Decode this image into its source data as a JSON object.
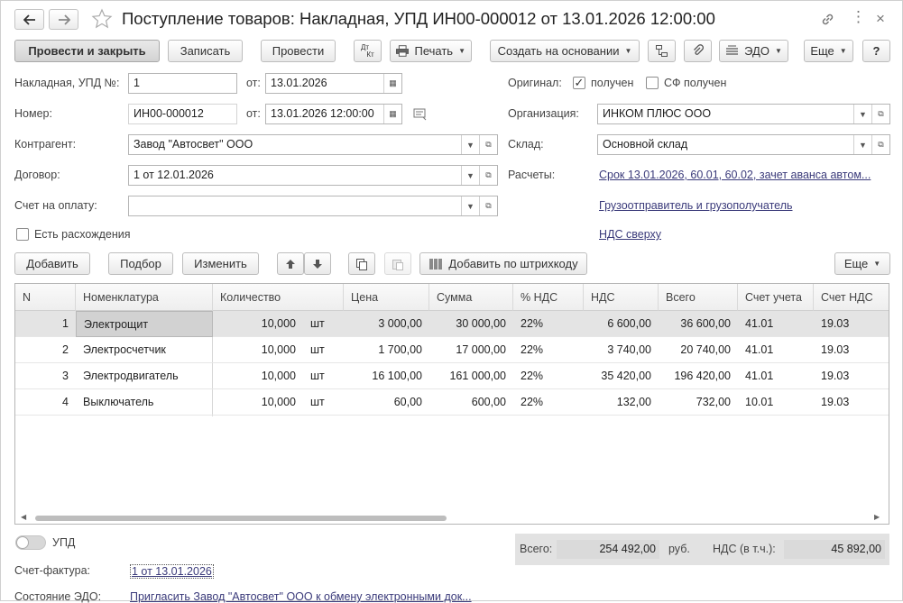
{
  "window": {
    "title": "Поступление товаров: Накладная, УПД ИН00-000012 от 13.01.2026 12:00:00",
    "back_icon": "arrow-left-icon",
    "forward_icon": "arrow-right-icon",
    "favorite_icon": "star-icon",
    "link_icon": "link-icon",
    "more_icon": "dots-icon",
    "close_icon": "close-icon"
  },
  "toolbar": {
    "post_close": "Провести и закрыть",
    "save": "Записать",
    "post": "Провести",
    "dtkt_top": "Дт",
    "dtkt_bottom": "Кт",
    "print": "Печать",
    "create_based": "Создать на основании",
    "edo": "ЭДО",
    "more": "Еще",
    "help": "?"
  },
  "form": {
    "invoice_label": "Накладная, УПД №:",
    "invoice_value": "1",
    "from_label": "от:",
    "invoice_date": "13.01.2026",
    "number_label": "Номер:",
    "number_value": "ИН00-000012",
    "number_date": "13.01.2026 12:00:00",
    "contractor_label": "Контрагент:",
    "contractor_value": "Завод \"Автосвет\" ООО",
    "contract_label": "Договор:",
    "contract_value": "1 от 12.01.2026",
    "payment_label": "Счет на оплату:",
    "payment_value": "",
    "discrepancy_label": "Есть расхождения",
    "original_label": "Оригинал:",
    "received_label": "получен",
    "sf_received_label": "СФ получен",
    "org_label": "Организация:",
    "org_value": "ИНКОМ ПЛЮС ООО",
    "warehouse_label": "Склад:",
    "warehouse_value": "Основной склад",
    "settlements_label": "Расчеты:",
    "settlements_link": "Срок 13.01.2026, 60.01, 60.02, зачет аванса автом...",
    "shipper_link": "Грузоотправитель и грузополучатель",
    "vat_link": "НДС сверху"
  },
  "table_toolbar": {
    "add": "Добавить",
    "pick": "Подбор",
    "edit": "Изменить",
    "barcode": "Добавить по штрихкоду",
    "more": "Еще"
  },
  "table": {
    "headers": [
      "N",
      "Номенклатура",
      "Количество",
      "Цена",
      "Сумма",
      "% НДС",
      "НДС",
      "Всего",
      "Счет учета",
      "Счет НДС"
    ],
    "rows": [
      {
        "n": "1",
        "name": "Электрощит",
        "qty": "10,000",
        "unit": "шт",
        "price": "3 000,00",
        "sum": "30 000,00",
        "vat_rate": "22%",
        "vat": "6 600,00",
        "total": "36 600,00",
        "account": "41.01",
        "vat_account": "19.03"
      },
      {
        "n": "2",
        "name": "Электросчетчик",
        "qty": "10,000",
        "unit": "шт",
        "price": "1 700,00",
        "sum": "17 000,00",
        "vat_rate": "22%",
        "vat": "3 740,00",
        "total": "20 740,00",
        "account": "41.01",
        "vat_account": "19.03"
      },
      {
        "n": "3",
        "name": "Электродвигатель",
        "qty": "10,000",
        "unit": "шт",
        "price": "16 100,00",
        "sum": "161 000,00",
        "vat_rate": "22%",
        "vat": "35 420,00",
        "total": "196 420,00",
        "account": "41.01",
        "vat_account": "19.03"
      },
      {
        "n": "4",
        "name": "Выключатель",
        "qty": "10,000",
        "unit": "шт",
        "price": "60,00",
        "sum": "600,00",
        "vat_rate": "22%",
        "vat": "132,00",
        "total": "732,00",
        "account": "10.01",
        "vat_account": "19.03"
      }
    ]
  },
  "footer": {
    "upd_label": "УПД",
    "total_label": "Всего:",
    "total_value": "254 492,00",
    "currency": "руб.",
    "vat_incl_label": "НДС (в т.ч.):",
    "vat_incl_value": "45 892,00",
    "invoice_label": "Счет-фактура:",
    "invoice_link": "1 от 13.01.2026",
    "edo_label": "Состояние ЭДО:",
    "edo_link": "Пригласить Завод \"Автосвет\" ООО к обмену электронными док..."
  }
}
